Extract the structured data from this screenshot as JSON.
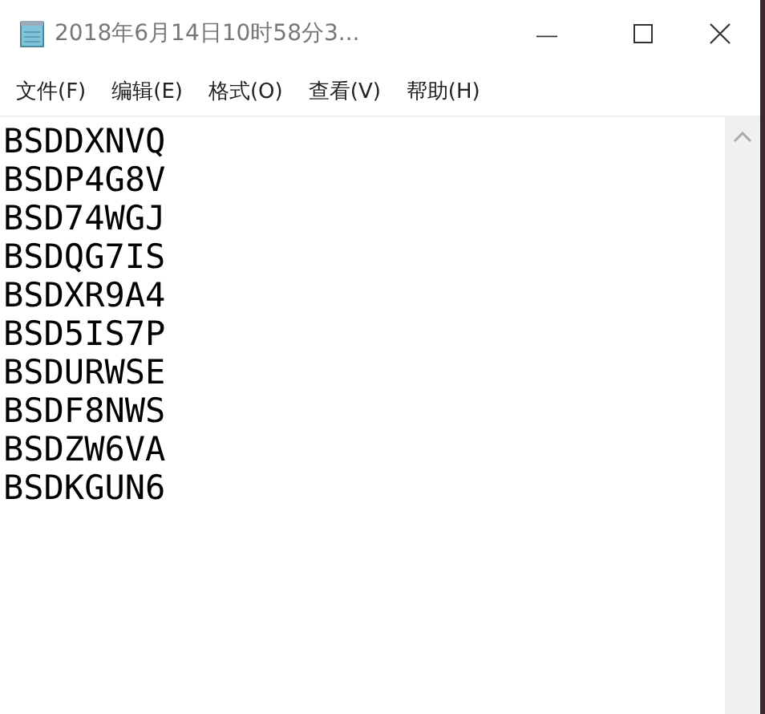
{
  "window": {
    "title": "2018年6月14日10时58分3..."
  },
  "window_controls": {
    "minimize": "—"
  },
  "menu": [
    "文件(F)",
    "编辑(E)",
    "格式(O)",
    "查看(V)",
    "帮助(H)"
  ],
  "document": {
    "lines": [
      "BSDDXNVQ",
      "BSDP4G8V",
      "BSD74WGJ",
      "BSDQG7IS",
      "BSDXR9A4",
      "BSD5IS7P",
      "BSDURWSE",
      "BSDF8NWS",
      "BSDZW6VA",
      "BSDKGUN6"
    ]
  }
}
